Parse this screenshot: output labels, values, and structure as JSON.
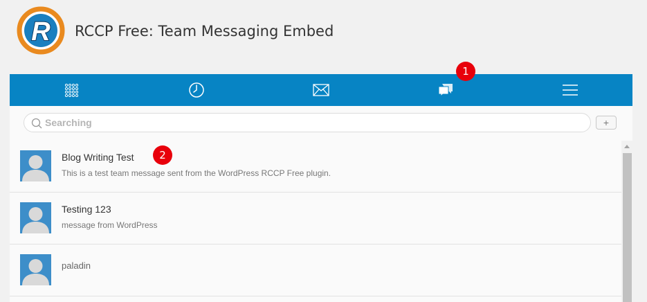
{
  "header": {
    "title": "RCCP Free: Team Messaging Embed",
    "logo_letter": "R",
    "logo_ring_color": "#e98a1f",
    "logo_inner_color": "#1a7fbf"
  },
  "tabbar": {
    "color": "#0784c4",
    "tabs": [
      {
        "icon": "keypad-icon"
      },
      {
        "icon": "clock-icon"
      },
      {
        "icon": "mail-icon"
      },
      {
        "icon": "chat-bubbles-icon"
      },
      {
        "icon": "hamburger-menu-icon"
      }
    ]
  },
  "annotations": {
    "badge_1": "1",
    "badge_2": "2",
    "color": "#e8000b"
  },
  "search": {
    "placeholder": "Searching",
    "value": "",
    "add_label": "+"
  },
  "messages": [
    {
      "name": "Blog Writing Test",
      "preview": "This is a test team message sent from the WordPress RCCP Free plugin."
    },
    {
      "name": "Testing 123",
      "preview": "message from WordPress"
    },
    {
      "name": "paladin",
      "preview": ""
    }
  ]
}
